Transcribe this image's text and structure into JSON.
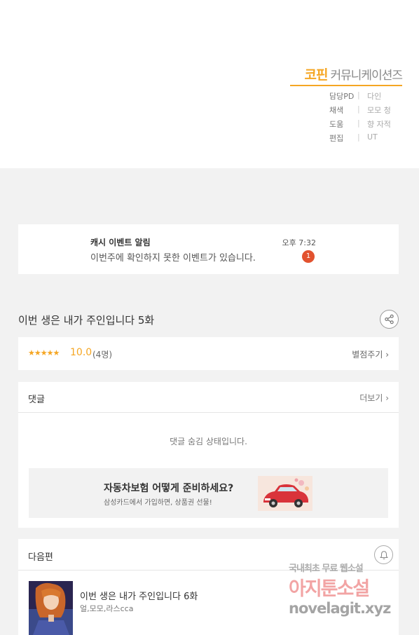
{
  "credits": {
    "logo_main": "코핀",
    "logo_sub": "커뮤니케이션즈",
    "lines": [
      {
        "role": "담당PD",
        "sep": "|",
        "name": "다인"
      },
      {
        "role": "채색",
        "sep": "|",
        "name": "모모 청"
      },
      {
        "role": "도움",
        "sep": "|",
        "name": "향 자적"
      },
      {
        "role": "편집",
        "sep": "|",
        "name": "UT"
      }
    ]
  },
  "notification": {
    "title": "캐시 이벤트 알림",
    "text": "이번주에 확인하지 못한 이벤트가 있습니다.",
    "time": "오후 7:32",
    "badge": "1"
  },
  "episode": {
    "title": "이번 생은 내가 주인입니다 5화"
  },
  "rating": {
    "stars": "★★★★★",
    "score": "10.0",
    "count": "(4명)",
    "rate_link": "별점주기 ›"
  },
  "comments": {
    "label": "댓글",
    "more": "더보기 ›",
    "hidden_text": "댓글 숨김 상태입니다."
  },
  "ad": {
    "title": "자동차보험 어떻게 준비하세요?",
    "subtitle": "삼성카드에서 가입하면, 상품권 선물!"
  },
  "next": {
    "label": "다음편",
    "title": "이번 생은 내가 주인입니다 6화",
    "authors": "얼,모모,라스cca"
  },
  "watermark": {
    "line1": "국내최초 무료 웹소설",
    "line2": "아지툰소설",
    "line3": "novelagit.xyz"
  },
  "colors": {
    "accent": "#f5a623",
    "badge": "#e2522f",
    "background": "#f2f2f2"
  }
}
